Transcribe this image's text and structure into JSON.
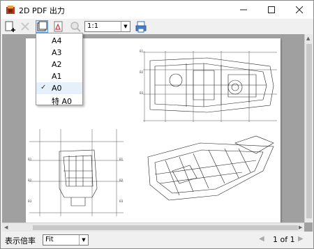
{
  "window": {
    "title": "2D PDF 出力"
  },
  "toolbar": {
    "zoom_value": "1:1",
    "icons": [
      "new-page-icon",
      "delete-icon",
      "paper-size-icon",
      "pdf-export-icon",
      "zoom-icon",
      "print-icon"
    ]
  },
  "paper_menu": {
    "items": [
      {
        "label": "A4",
        "checked": false
      },
      {
        "label": "A3",
        "checked": false
      },
      {
        "label": "A2",
        "checked": false
      },
      {
        "label": "A1",
        "checked": false
      },
      {
        "label": "A0",
        "checked": true
      },
      {
        "label": "特 A0",
        "checked": false
      }
    ],
    "check_mark": "✓"
  },
  "status": {
    "ratio_label": "表示倍率",
    "ratio_value": "Fit",
    "page_indicator": "1 of 1"
  },
  "colors": {
    "accent": "#5a9ad8",
    "viewer_bg": "#a0a0a0",
    "selected_bg": "#cce4f7"
  }
}
